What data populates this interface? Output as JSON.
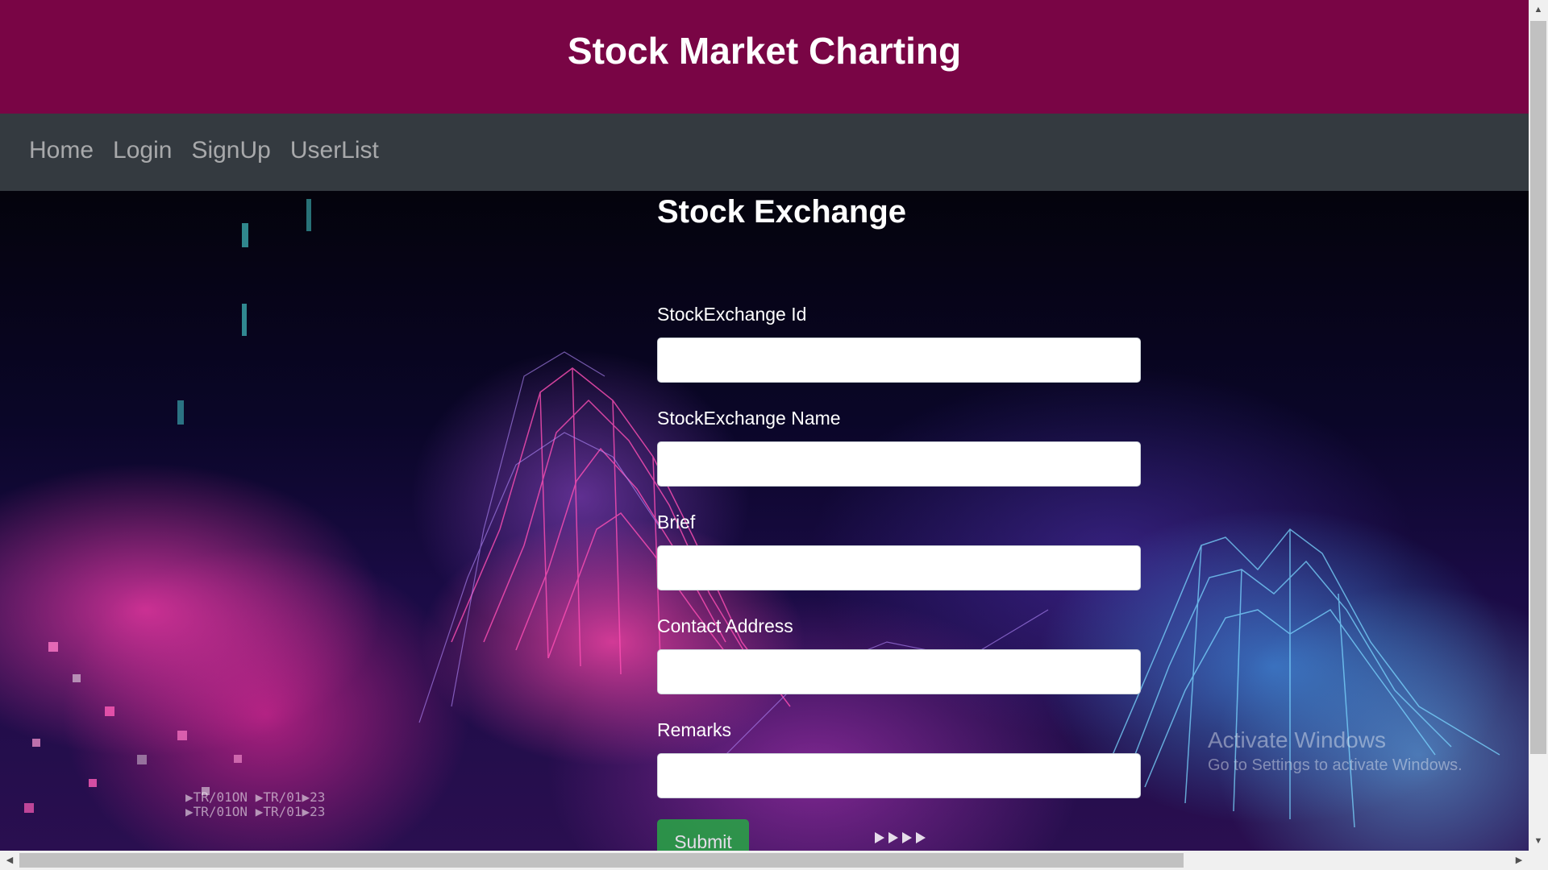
{
  "header": {
    "title": "Stock Market Charting"
  },
  "nav": {
    "items": [
      {
        "label": "Home"
      },
      {
        "label": "Login"
      },
      {
        "label": "SignUp"
      },
      {
        "label": "UserList"
      }
    ]
  },
  "form": {
    "title": "Stock Exchange",
    "fields": [
      {
        "label": "StockExchange Id",
        "value": ""
      },
      {
        "label": "StockExchange Name",
        "value": ""
      },
      {
        "label": "Brief",
        "value": ""
      },
      {
        "label": "Contact Address",
        "value": ""
      },
      {
        "label": "Remarks",
        "value": ""
      }
    ],
    "submit_label": "Submit"
  },
  "watermark": {
    "title": "Activate Windows",
    "subtitle": "Go to Settings to activate Windows."
  },
  "colors": {
    "header_bg": "#790545",
    "navbar_bg": "#343a40",
    "nav_link": "#a8a9ab",
    "submit_bg": "#28a745"
  }
}
